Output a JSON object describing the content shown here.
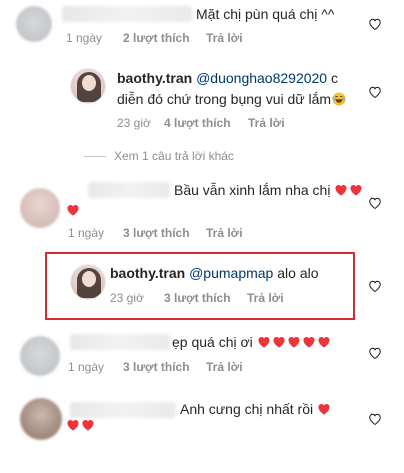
{
  "comments": [
    {
      "text": "Mặt chị pùn quá chị ^^",
      "time": "1 ngày",
      "likes": "2 lượt thích",
      "reply": "Trả lời"
    },
    {
      "username": "baothy.tran",
      "mention": "@duonghao8292020",
      "text_tail": " c",
      "line2": "diễn đó chứ trong bụng vui dữ lắm",
      "time": "23 giờ",
      "likes": "4 lượt thích",
      "reply": "Trả lời"
    },
    {
      "text": "Bầu vẫn xinh lắm nha chị",
      "time": "1 ngày",
      "likes": "3 lượt thích",
      "reply": "Trả lời"
    },
    {
      "username": "baothy.tran",
      "mention": "@pumapmap",
      "text": " alo alo",
      "time": "23 giờ",
      "likes": "3 lượt thích",
      "reply": "Trả lời"
    },
    {
      "text": "ẹp quá chị ơi",
      "time": "1 ngày",
      "likes": "3 lượt thích",
      "reply": "Trả lời"
    },
    {
      "text": "Anh cưng chị nhất rồi"
    }
  ],
  "view_more_replies": "Xem 1 câu trả lời khác",
  "icons": {
    "heart": "heart-outline-icon",
    "emoji_laugh": "laughing-emoji-icon",
    "emoji_heart": "red-heart-emoji-icon"
  },
  "colors": {
    "highlight": "#d9292f",
    "mention": "#00376b",
    "heart_emoji": "#ed333b"
  }
}
